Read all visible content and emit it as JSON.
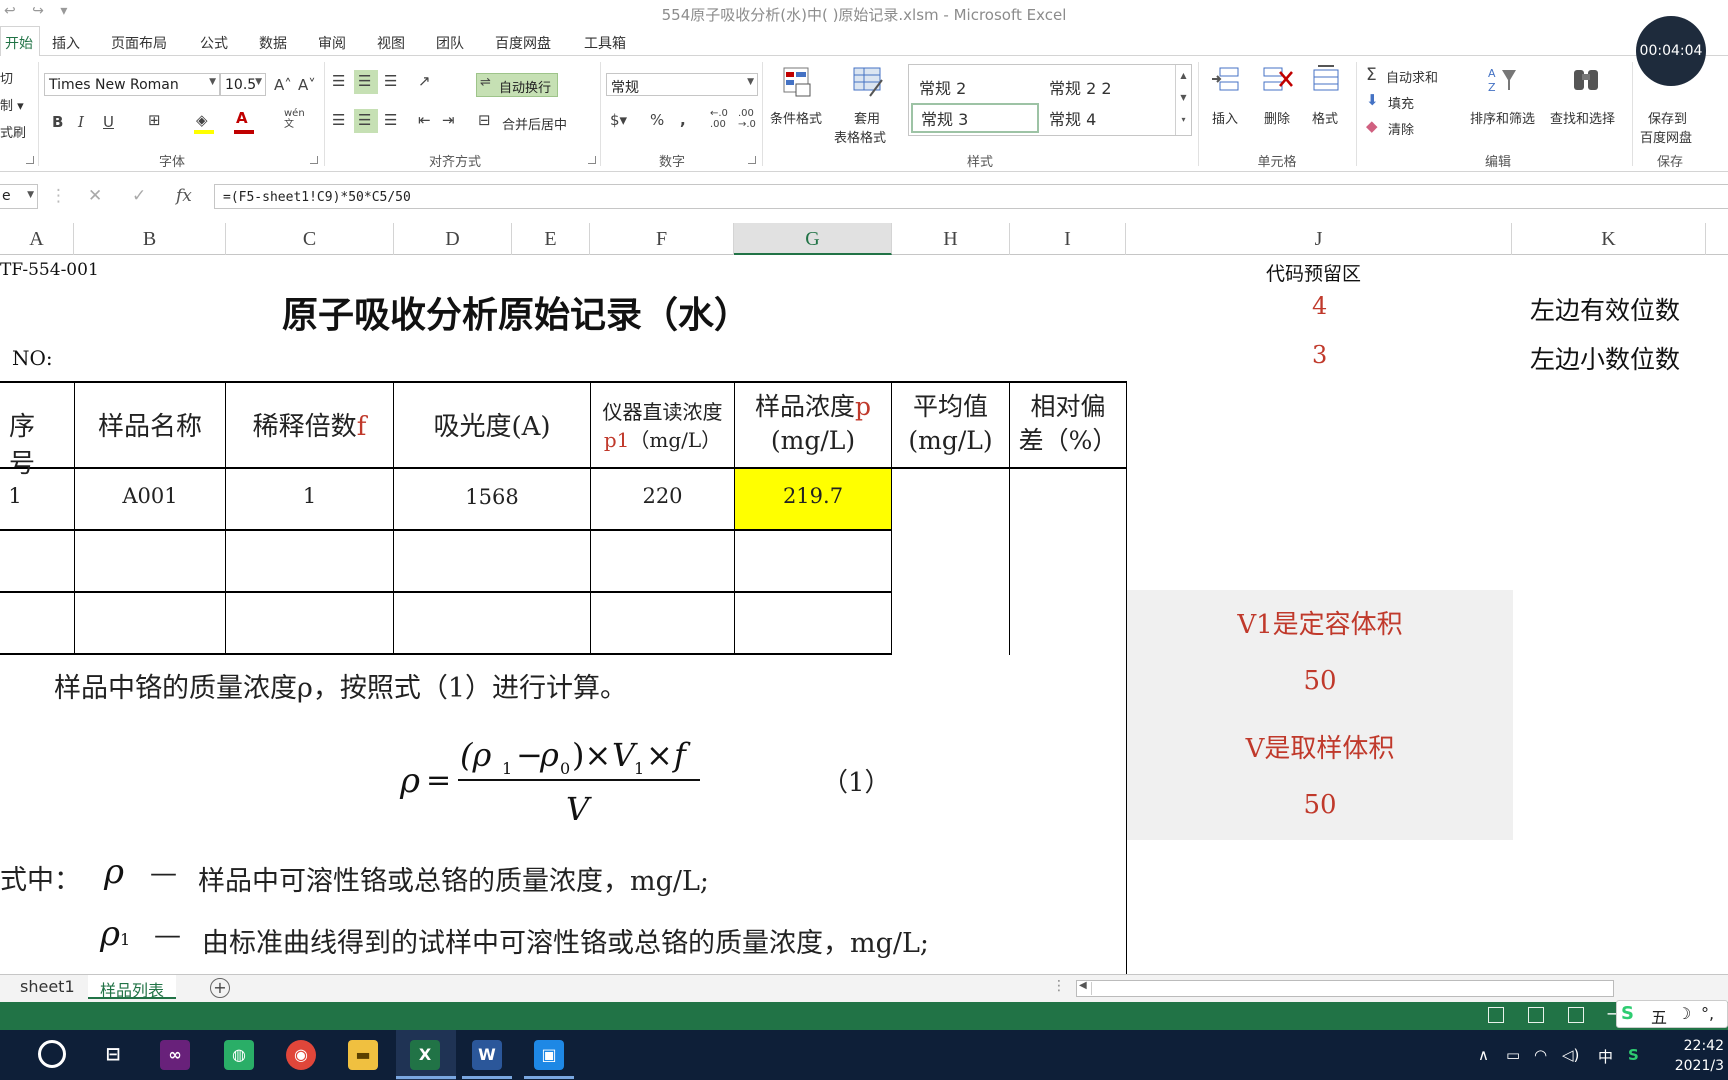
{
  "window": {
    "title": "554原子吸收分析(水)中( )原始记录.xlsm - Microsoft Excel",
    "quick_access": "↩ ↪ ▾",
    "right_mark": "? ▣"
  },
  "ribbon_tabs": [
    {
      "label": "开始",
      "active": true
    },
    {
      "label": "插入"
    },
    {
      "label": "页面布局"
    },
    {
      "label": "公式"
    },
    {
      "label": "数据"
    },
    {
      "label": "审阅"
    },
    {
      "label": "视图"
    },
    {
      "label": "团队"
    },
    {
      "label": "百度网盘"
    },
    {
      "label": "工具箱"
    }
  ],
  "ribbon": {
    "clipboard": {
      "cut": "切",
      "copy": "制 ▾",
      "format_painter": "式刷"
    },
    "font": {
      "name": "Times New Roman",
      "size": "10.5",
      "grow": "A˄",
      "shrink": "A˅",
      "bold": "B",
      "italic": "I",
      "underline": "U",
      "phonetic": "wén\n文",
      "group_label": "字体"
    },
    "alignment": {
      "wrap_text": "自动换行",
      "merge_center": "合并后居中",
      "group_label": "对齐方式"
    },
    "number": {
      "format": "常规",
      "percent": "%",
      "comma": ",",
      "inc_dec": "←.0\n.00",
      "dec_dec": ".00\n→.0",
      "group_label": "数字"
    },
    "styles": {
      "conditional_format": "条件格式",
      "table_format_1": "套用",
      "table_format_2": "表格格式",
      "gallery": [
        "常规 2",
        "常规 2 2",
        "常规 3",
        "常规 4"
      ],
      "group_label": "样式"
    },
    "cells": {
      "insert": "插入",
      "delete": "删除",
      "format": "格式",
      "group_label": "单元格"
    },
    "editing": {
      "autosum": "自动求和",
      "fill": "填充",
      "clear": "清除",
      "sort_filter": "排序和筛选",
      "find_select": "查找和选择",
      "group_label": "编辑"
    },
    "save": {
      "line1": "保存到",
      "line2": "百度网盘",
      "group_label": "保存"
    }
  },
  "recording_timer": "00:04:04",
  "formula_bar": {
    "name_box": "e",
    "cancel": "✕",
    "enter": "✓",
    "fx": "fx",
    "formula": "=(F5-sheet1!C9)*50*C5/50"
  },
  "columns": [
    "A",
    "B",
    "C",
    "D",
    "E",
    "F",
    "G",
    "H",
    "I",
    "J",
    "K"
  ],
  "selected_column": "G",
  "sheet": {
    "doc_code": "TF-554-001",
    "title": "原子吸收分析原始记录（水）",
    "no_label": "NO:",
    "code_area_label": "代码预留区",
    "sig_digits_value": "4",
    "sig_digits_label": "左边有效位数",
    "decimals_value": "3",
    "decimals_label": "左边小数位数",
    "table_headers": {
      "seq": "序号",
      "sample_name": "样品名称",
      "dilution_a": "稀释倍数",
      "dilution_b": "f",
      "absorbance": "吸光度(A)",
      "direct_1": "仪器直读浓度",
      "direct_2a": "p1",
      "direct_2b": "（mg/L）",
      "conc_1a": "样品浓度",
      "conc_1b": "p",
      "conc_2": "(mg/L)",
      "avg_1": "平均值",
      "avg_2": "(mg/L)",
      "dev_1": "相对偏",
      "dev_2": "差（%）"
    },
    "rows": [
      {
        "seq": "1",
        "sample_name": "A001",
        "dilution": "1",
        "absorbance": "1568",
        "direct": "220",
        "conc": "219.7",
        "avg": "",
        "dev": ""
      },
      {
        "seq": "",
        "sample_name": "",
        "dilution": "",
        "absorbance": "",
        "direct": "",
        "conc": "",
        "avg": "",
        "dev": ""
      },
      {
        "seq": "",
        "sample_name": "",
        "dilution": "",
        "absorbance": "",
        "direct": "",
        "conc": "",
        "avg": "",
        "dev": ""
      }
    ],
    "volume_panel": {
      "v1_label": "V1是定容体积",
      "v1_value": "50",
      "v_label": "V是取样体积",
      "v_value": "50"
    },
    "method_text": {
      "line1": "样品中铬的质量浓度ρ，按照式（1）进行计算。",
      "eq_number": "（1）",
      "where_label": "式中：",
      "rho_def": "样品中可溶性铬或总铬的质量浓度，mg/L;",
      "rho1_def": "由标准曲线得到的试样中可溶性铬或总铬的质量浓度，mg/L;"
    }
  },
  "sheet_tabs": [
    {
      "label": "sheet1",
      "active": false
    },
    {
      "label": "样品列表",
      "active": true
    }
  ],
  "taskbar": {
    "ime": "五",
    "lang": "中",
    "time": "22:42",
    "date": "2021/3"
  },
  "colors": {
    "excel_green": "#217346",
    "highlight_yellow": "#ffff00",
    "red_text": "#c0392b",
    "panel_gray": "#f0f0f0"
  }
}
